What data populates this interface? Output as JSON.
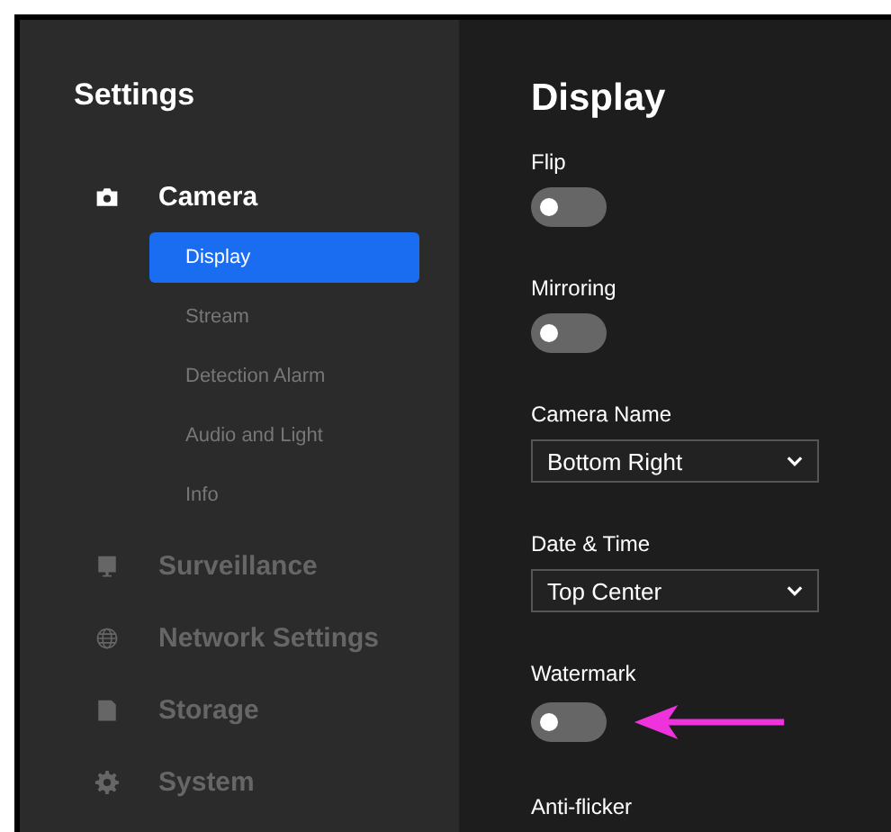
{
  "sidebar": {
    "title": "Settings",
    "sections": [
      {
        "label": "Camera",
        "kind": "camera",
        "expanded": true,
        "children": [
          {
            "label": "Display",
            "selected": true
          },
          {
            "label": "Stream",
            "selected": false
          },
          {
            "label": "Detection Alarm",
            "selected": false
          },
          {
            "label": "Audio and Light",
            "selected": false
          },
          {
            "label": "Info",
            "selected": false
          }
        ]
      },
      {
        "label": "Surveillance",
        "kind": "monitor",
        "expanded": false
      },
      {
        "label": "Network Settings",
        "kind": "globe",
        "expanded": false
      },
      {
        "label": "Storage",
        "kind": "storage",
        "expanded": false
      },
      {
        "label": "System",
        "kind": "gear",
        "expanded": false
      }
    ]
  },
  "main": {
    "title": "Display",
    "settings": [
      {
        "kind": "toggle",
        "label": "Flip",
        "on": false
      },
      {
        "kind": "toggle",
        "label": "Mirroring",
        "on": false
      },
      {
        "kind": "select",
        "label": "Camera Name",
        "value": "Bottom Right"
      },
      {
        "kind": "select",
        "label": "Date & Time",
        "value": "Top Center"
      },
      {
        "kind": "toggle",
        "label": "Watermark",
        "on": false,
        "annotated": true
      },
      {
        "kind": "heading",
        "label": "Anti-flicker"
      }
    ]
  }
}
